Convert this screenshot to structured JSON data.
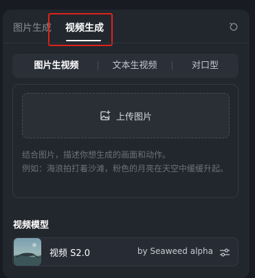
{
  "tabs": {
    "image_gen": "图片生成",
    "video_gen": "视频生成"
  },
  "mode": {
    "items": [
      "图片生视频",
      "文本生视频",
      "对口型"
    ],
    "selected": "图片生视频"
  },
  "upload": {
    "label": "上传图片",
    "icon": "image-add-icon"
  },
  "prompt": {
    "placeholder_line1": "结合图片，描述你想生成的画面和动作。",
    "placeholder_line2": "例如：海浪拍打着沙滩，粉色的月亮在天空中缓缓升起。"
  },
  "model": {
    "section_title": "视频模型",
    "name": "视频 S2.0",
    "provider": "by Seaweed alpha"
  },
  "colors": {
    "highlight": "#e0231c",
    "panel": "#22262d",
    "page": "#181c22"
  }
}
